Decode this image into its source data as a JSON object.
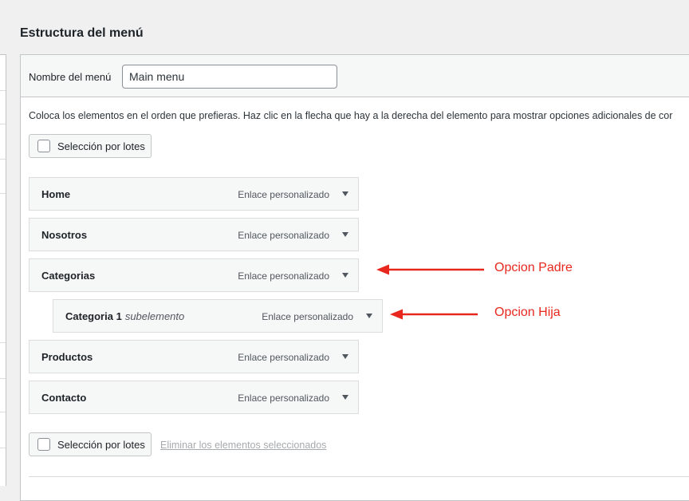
{
  "section_title": "Estructura del menú",
  "menu_name": {
    "label": "Nombre del menú",
    "value": "Main menu"
  },
  "instructions": "Coloca los elementos en el orden que prefieras. Haz clic en la flecha que hay a la derecha del elemento para mostrar opciones adicionales de cor",
  "bulk_select_label": "Selección por lotes",
  "delete_selected_label": "Eliminar los elementos seleccionados",
  "items": [
    {
      "title": "Home",
      "subtitle": "",
      "type": "Enlace personalizado"
    },
    {
      "title": "Nosotros",
      "subtitle": "",
      "type": "Enlace personalizado"
    },
    {
      "title": "Categorias",
      "subtitle": "",
      "type": "Enlace personalizado"
    },
    {
      "title": "Categoria 1",
      "subtitle": "subelemento",
      "type": "Enlace personalizado"
    },
    {
      "title": "Productos",
      "subtitle": "",
      "type": "Enlace personalizado"
    },
    {
      "title": "Contacto",
      "subtitle": "",
      "type": "Enlace personalizado"
    }
  ],
  "annotations": {
    "parent_label": "Opcion Padre",
    "child_label": "Opcion Hija",
    "color": "#e8281e"
  }
}
